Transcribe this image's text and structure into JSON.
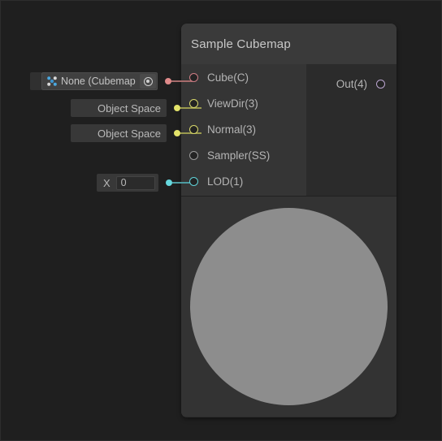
{
  "canvas": {
    "background": "#1f1f1f"
  },
  "node": {
    "title": "Sample Cubemap",
    "header_color": "#3a3a3a",
    "body_color": "#2b2b2b",
    "input_ports": [
      {
        "label": "Cube(C)",
        "type": "cube",
        "color": "#cf7d85",
        "connected": true
      },
      {
        "label": "ViewDir(3)",
        "type": "yellow",
        "color": "#d8d86a",
        "connected": true
      },
      {
        "label": "Normal(3)",
        "type": "yellow",
        "color": "#d8d86a",
        "connected": true
      },
      {
        "label": "Sampler(SS)",
        "type": "gray",
        "color": "#9a9a9a",
        "connected": false
      },
      {
        "label": "LOD(1)",
        "type": "cyan",
        "color": "#5fd2d8",
        "connected": true
      }
    ],
    "output_port": {
      "label": "Out(4)",
      "color": "#bba6d0"
    },
    "preview": {
      "background": "#333333",
      "sphere_color": "#8d8d8d",
      "shape": "sphere"
    }
  },
  "inputs": {
    "cubemap": {
      "value": "None (Cubemap)",
      "icon": "cubemap-asset-icon",
      "picker_icon": "object-picker-icon"
    },
    "viewdir": {
      "value": "Object Space"
    },
    "normal": {
      "value": "Object Space"
    },
    "lod": {
      "axis_label": "X",
      "value": "0"
    }
  }
}
